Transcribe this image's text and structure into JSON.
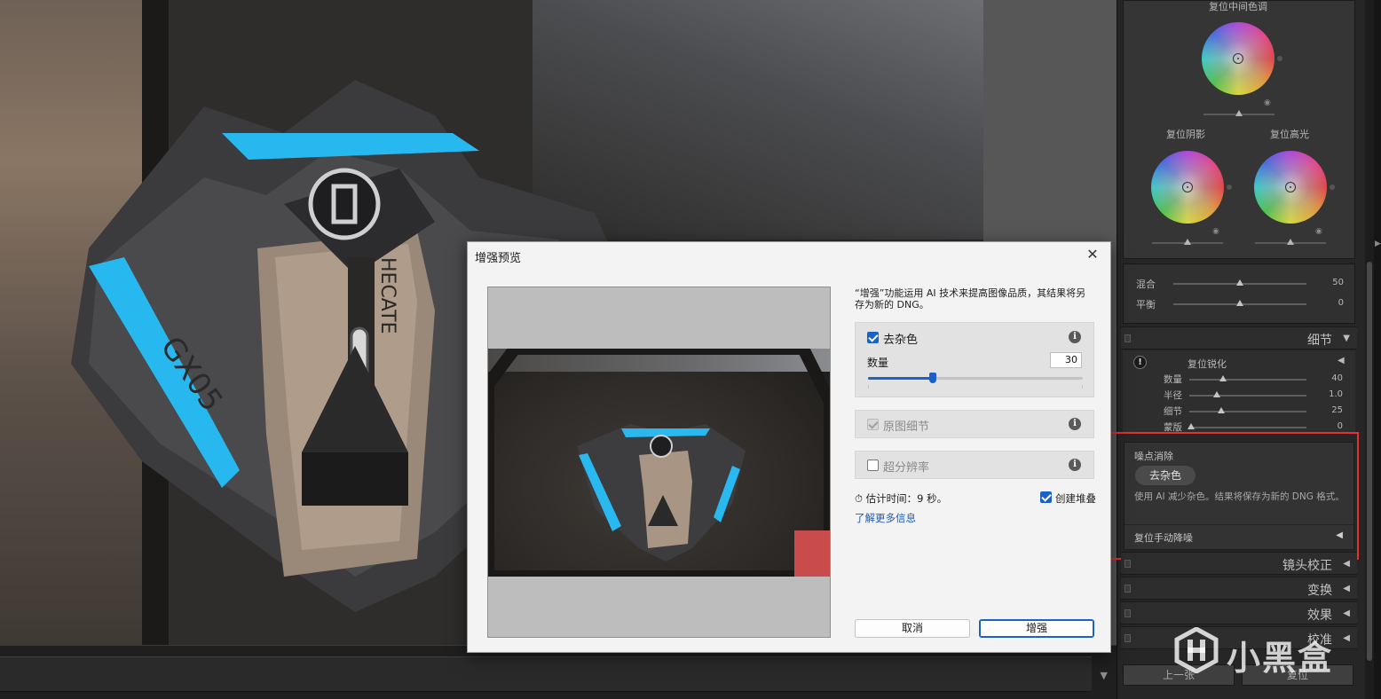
{
  "right_panel": {
    "grading": {
      "midtones_label": "复位中间色调",
      "shadows_label": "复位阴影",
      "highlights_label": "复位高光",
      "blend_label": "混合",
      "blend_value": "50",
      "balance_label": "平衡",
      "balance_value": "0"
    },
    "detail": {
      "header": "细节",
      "sharpen_label": "复位锐化",
      "rows": [
        {
          "label": "数量",
          "value": "40"
        },
        {
          "label": "半径",
          "value": "1.0"
        },
        {
          "label": "细节",
          "value": "25"
        },
        {
          "label": "蒙版",
          "value": "0"
        }
      ]
    },
    "noise": {
      "label": "噪点消除",
      "denoise_button": "去杂色",
      "description": "使用 AI 减少杂色。结果将保存为新的 DNG 格式。",
      "manual_label": "复位手动降噪"
    },
    "panels": [
      "镜头校正",
      "变换",
      "效果",
      "校准"
    ],
    "buttons": {
      "prev": "上一张",
      "reset": "复位"
    }
  },
  "dialog": {
    "title": "增强预览",
    "close": "✕",
    "description": "“增强”功能运用 AI 技术来提高图像品质，其结果将另存为新的 DNG。",
    "denoise": {
      "label": "去杂色",
      "checked": true,
      "amount_label": "数量",
      "amount": "30",
      "amount_fraction": 0.3
    },
    "raw_details": {
      "label": "原图细节",
      "checked": true,
      "disabled": true
    },
    "super_res": {
      "label": "超分辨率",
      "checked": false
    },
    "estimate": "估计时间：9 秒。",
    "stack_label": "创建堆叠",
    "learn_more": "了解更多信息",
    "cancel": "取消",
    "enhance": "增强"
  },
  "watermark": {
    "text": "小黑盒"
  },
  "colors": {
    "accent": "#1a62c8",
    "highlight_box": "#e2312f",
    "panel_bg": "#262626"
  }
}
